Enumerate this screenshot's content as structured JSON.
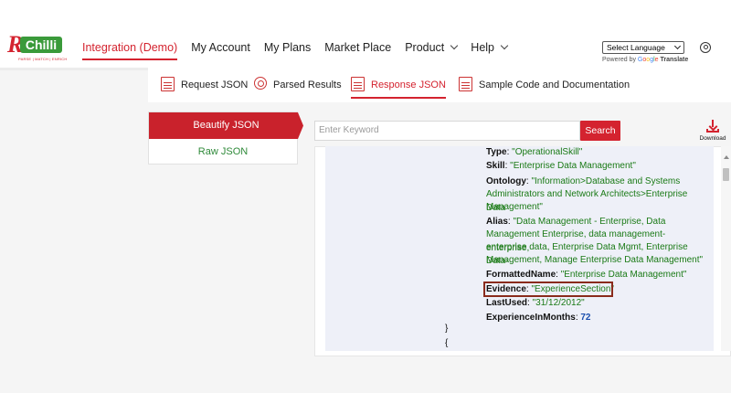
{
  "brand": {
    "logo_mark": "R",
    "logo_word": "Chilli",
    "tagline": "PARSE | MATCH | ENRICH"
  },
  "nav": {
    "items": [
      {
        "label": "Integration (Demo)",
        "active": true,
        "has_dropdown": false
      },
      {
        "label": "My Account",
        "active": false,
        "has_dropdown": false
      },
      {
        "label": "My Plans",
        "active": false,
        "has_dropdown": false
      },
      {
        "label": "Market Place",
        "active": false,
        "has_dropdown": false
      },
      {
        "label": "Product",
        "active": false,
        "has_dropdown": true
      },
      {
        "label": "Help",
        "active": false,
        "has_dropdown": true
      }
    ]
  },
  "language": {
    "selected": "Select Language",
    "powered_by": "Powered by",
    "google": [
      "G",
      "o",
      "o",
      "g",
      "l",
      "e"
    ],
    "translate": "Translate"
  },
  "subtabs": [
    {
      "label": "Request JSON",
      "icon": "json-doc-icon",
      "active": false
    },
    {
      "label": "Parsed Results",
      "icon": "gear-icon",
      "active": false
    },
    {
      "label": "Response JSON",
      "icon": "json-doc-icon",
      "active": true
    },
    {
      "label": "Sample Code and Documentation",
      "icon": "doc-icon",
      "active": false
    }
  ],
  "view_options": {
    "beautify": "Beautify JSON",
    "raw": "Raw JSON",
    "selected": "Beautify JSON"
  },
  "search": {
    "placeholder": "Enter Keyword",
    "button": "Search"
  },
  "download": {
    "label": "Download"
  },
  "json": {
    "type_key": "Type",
    "type_val": "\"OperationalSkill\"",
    "skill_key": "Skill",
    "skill_val": "\"Enterprise Data Management\"",
    "ontology_key": "Ontology",
    "ontology_val_1": "\"Information>Database and Systems",
    "ontology_val_2": "Administrators and Network Architects>Enterprise Data",
    "ontology_val_3": "Management\"",
    "alias_key": "Alias",
    "alias_val_1": "\"Data Management - Enterprise, Data",
    "alias_val_2": "Management Enterprise, data management-enterprise,",
    "alias_val_3": "enterprise data, Enterprise Data Mgmt, Enterprise Data-",
    "alias_val_4": "Management, Manage Enterprise Data Management\"",
    "formatted_key": "FormattedName",
    "formatted_val": "\"Enterprise Data Management\"",
    "evidence_key": "Evidence",
    "evidence_val": "\"ExperienceSection\"",
    "lastused_key": "LastUsed",
    "lastused_val": "\"31/12/2012\"",
    "months_key": "ExperienceInMonths",
    "months_val": "72",
    "close_brace": "}",
    "open_brace": "{",
    "colon": ": "
  },
  "colors": {
    "accent": "#d4232f",
    "string_green": "#1a7a16",
    "number_blue": "#1b4fae",
    "json_bg": "#eef0f8",
    "highlight_border": "#8a2b1c"
  }
}
